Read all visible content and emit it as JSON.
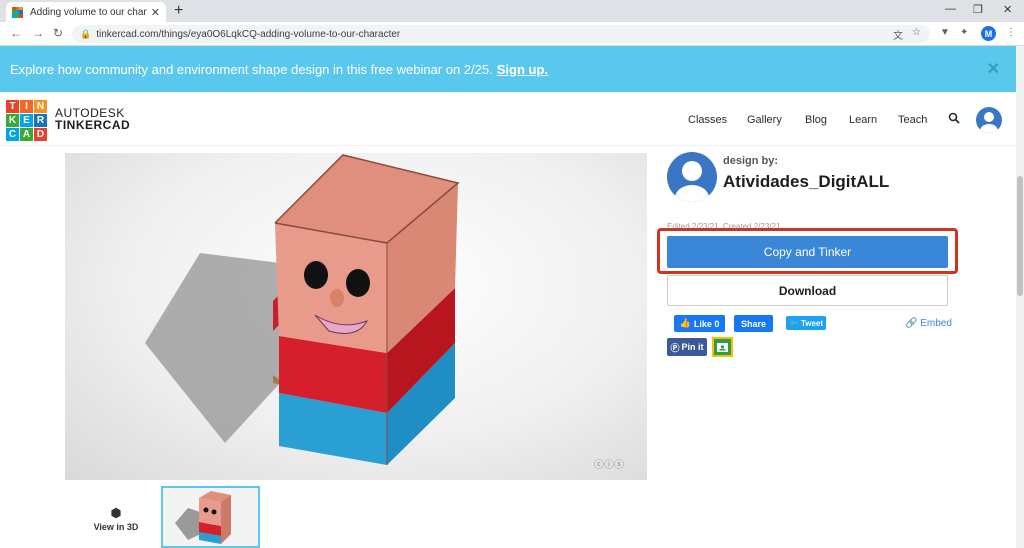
{
  "browser": {
    "tab_title": "Adding volume to our character",
    "tab_close": "✕",
    "new_tab": "+",
    "url": "tinkercad.com/things/eya0O6LqkCQ-adding-volume-to-our-character",
    "profile_initial": "M"
  },
  "banner": {
    "text": "Explore how community and environment shape design in this free webinar on 2/25.",
    "link": "Sign up.",
    "close": "✕"
  },
  "header": {
    "logo_letters": [
      "T",
      "I",
      "N",
      "K",
      "E",
      "R",
      "C",
      "A",
      "D"
    ],
    "logo_colors": [
      "#e8412c",
      "#f26522",
      "#f6921e",
      "#3aaa35",
      "#00a5e3",
      "#1c75bc",
      "#00a5e3",
      "#3aaa35",
      "#e8412c"
    ],
    "brand_line1": "AUTODESK",
    "brand_line2": "TINKERCAD",
    "nav": [
      "Classes",
      "Gallery",
      "Blog",
      "Learn",
      "Teach"
    ]
  },
  "viewer": {
    "view_in_3d": "View in 3D"
  },
  "designer": {
    "label": "design by:",
    "name": "Atividades_DigitALL",
    "dates": "Edited 2/23/21, Created 2/23/21"
  },
  "actions": {
    "copy": "Copy and Tinker",
    "download": "Download"
  },
  "social": {
    "like": "Like 0",
    "share": "Share",
    "tweet": "Tweet",
    "embed": "Embed",
    "pin": "Pin it"
  },
  "colors": {
    "banner": "#5ac8ec",
    "primary": "#3a87d8",
    "highlight": "#d0341f",
    "facebook": "#1877f2",
    "twitter": "#1da1f2",
    "pinterest": "#3b5998"
  }
}
